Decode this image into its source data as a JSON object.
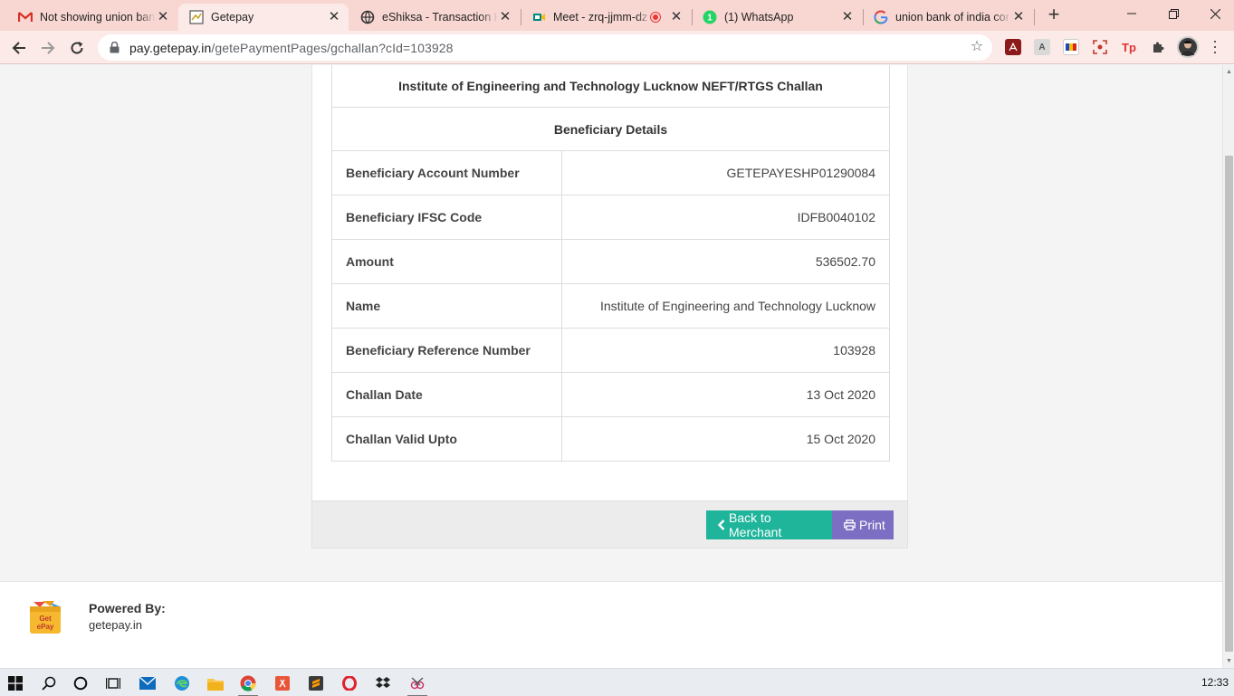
{
  "browser": {
    "tabs": [
      {
        "title": "Not showing union ban",
        "icon": "gmail-icon",
        "active": false
      },
      {
        "title": "Getepay",
        "icon": "getepay-icon",
        "active": true
      },
      {
        "title": "eShiksa - Transaction H",
        "icon": "eshiksa-icon",
        "active": false
      },
      {
        "title": "Meet - zrq-jjmm-dz",
        "icon": "meet-icon",
        "active": false
      },
      {
        "title": "(1) WhatsApp",
        "icon": "whatsapp-icon",
        "active": false
      },
      {
        "title": "union bank of india cor",
        "icon": "google-icon",
        "active": false
      }
    ],
    "url_host": "pay.getepay.in",
    "url_path": "/getePaymentPages/gchallan?cId=103928"
  },
  "challan": {
    "title": "Institute of Engineering and Technology Lucknow NEFT/RTGS Challan",
    "section_heading": "Beneficiary Details",
    "rows": [
      {
        "label": "Beneficiary Account Number",
        "value": "GETEPAYESHP01290084"
      },
      {
        "label": "Beneficiary IFSC Code",
        "value": "IDFB0040102"
      },
      {
        "label": "Amount",
        "value": "536502.70"
      },
      {
        "label": "Name",
        "value": "Institute of Engineering and Technology Lucknow"
      },
      {
        "label": "Beneficiary Reference Number",
        "value": "103928"
      },
      {
        "label": "Challan Date",
        "value": "13 Oct 2020"
      },
      {
        "label": "Challan Valid Upto",
        "value": "15 Oct 2020"
      }
    ]
  },
  "actions": {
    "back_label": "Back to Merchant",
    "print_label": "Print"
  },
  "footer": {
    "powered_by": "Powered By:",
    "site": "getepay.in",
    "logo_text_1": "Get",
    "logo_text_2": "ePay"
  },
  "taskbar": {
    "time": "12:33"
  },
  "colors": {
    "tabstrip": "#f8d7d2",
    "back_button": "#1fb59b",
    "print_button": "#7c6ec2"
  }
}
